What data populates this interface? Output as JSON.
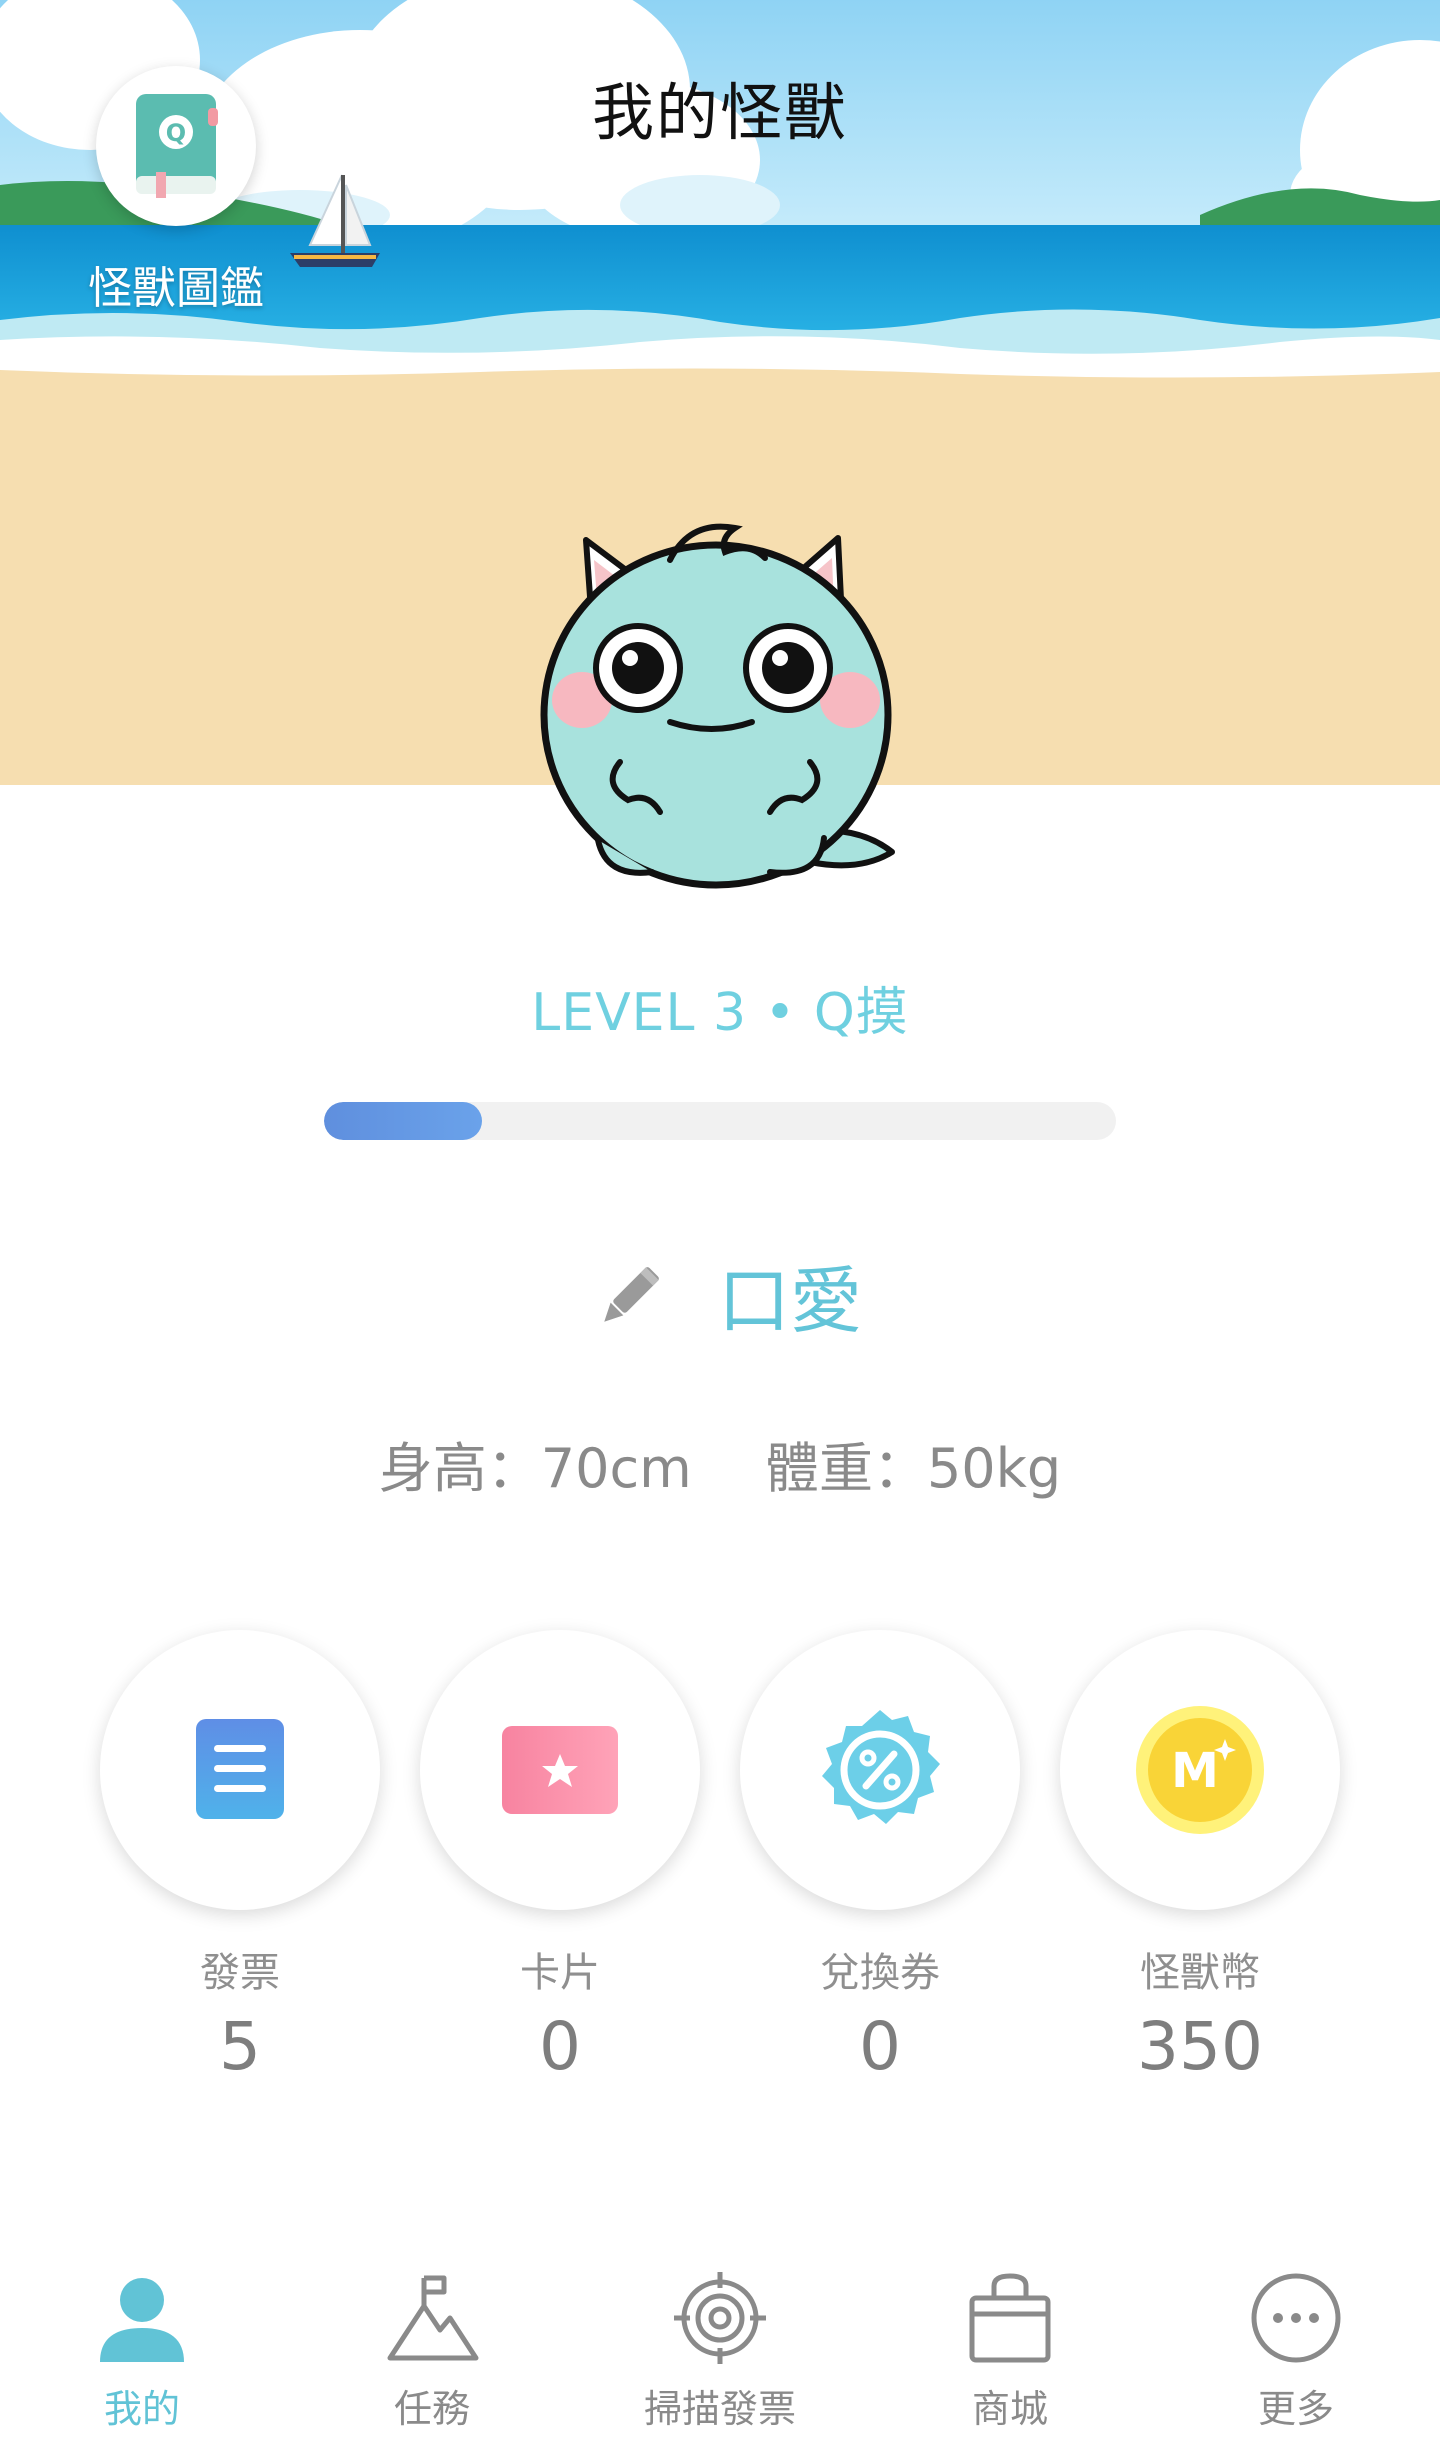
{
  "header": {
    "title": "我的怪獸"
  },
  "dex": {
    "label": "怪獸圖鑑",
    "badge": "Q"
  },
  "monster": {
    "level_text": "LEVEL 3 • Q摸",
    "progress_fraction": 0.2,
    "name": "口愛",
    "height_text": "身高：70cm",
    "weight_text": "體重：50kg"
  },
  "stats": [
    {
      "label": "發票",
      "value": "5",
      "icon": "invoice-icon"
    },
    {
      "label": "卡片",
      "value": "0",
      "icon": "card-icon"
    },
    {
      "label": "兌換券",
      "value": "0",
      "icon": "coupon-icon"
    },
    {
      "label": "怪獸幣",
      "value": "350",
      "icon": "coin-icon"
    }
  ],
  "coin_glyph": "M",
  "tabs": [
    {
      "label": "我的",
      "icon": "person-icon",
      "active": true
    },
    {
      "label": "任務",
      "icon": "mountain-flag-icon",
      "active": false
    },
    {
      "label": "掃描發票",
      "icon": "target-icon",
      "active": false
    },
    {
      "label": "商城",
      "icon": "shopping-bag-icon",
      "active": false
    },
    {
      "label": "更多",
      "icon": "more-icon",
      "active": false
    }
  ],
  "colors": {
    "accent": "#61c3d6",
    "progress": "#5f8fde",
    "monster_body": "#a8e2dd",
    "sand": "#f6deb0",
    "sea": "#1aa3dc",
    "sky": "#8fd3f4"
  }
}
